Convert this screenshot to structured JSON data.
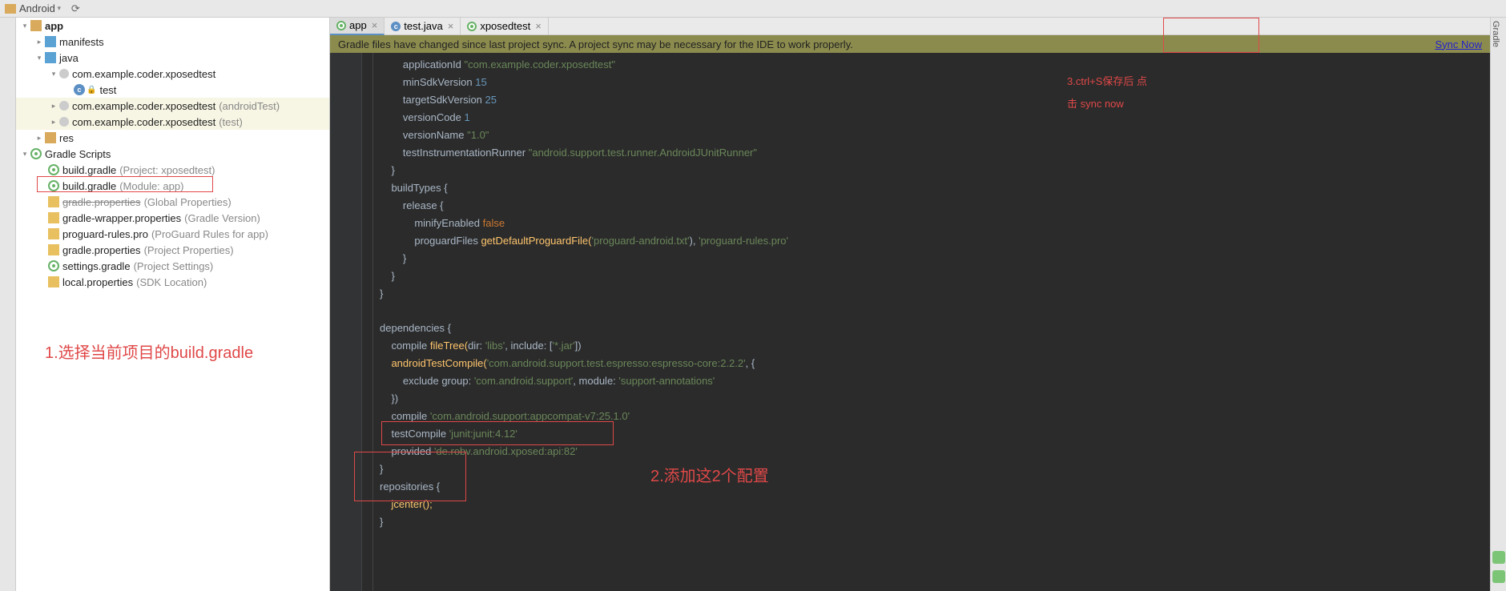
{
  "topbar": {
    "view_label": "Android"
  },
  "tree": {
    "app": "app",
    "manifests": "manifests",
    "java": "java",
    "pkg1": "com.example.coder.xposedtest",
    "test_class": "test",
    "pkg2": "com.example.coder.xposedtest",
    "pkg2_hint": "(androidTest)",
    "pkg3": "com.example.coder.xposedtest",
    "pkg3_hint": "(test)",
    "res": "res",
    "gradle_scripts": "Gradle Scripts",
    "bg_project": "build.gradle",
    "bg_project_hint": "(Project: xposedtest)",
    "bg_module": "build.gradle",
    "bg_module_hint": "(Module: app)",
    "gp_global": "gradle.properties",
    "gp_global_hint": "(Global Properties)",
    "gw": "gradle-wrapper.properties",
    "gw_hint": "(Gradle Version)",
    "proguard": "proguard-rules.pro",
    "proguard_hint": "(ProGuard Rules for app)",
    "gp_proj": "gradle.properties",
    "gp_proj_hint": "(Project Properties)",
    "settings": "settings.gradle",
    "settings_hint": "(Project Settings)",
    "local": "local.properties",
    "local_hint": "(SDK Location)"
  },
  "tabs": {
    "t1": "app",
    "t2": "test.java",
    "t3": "xposedtest"
  },
  "syncbar": {
    "msg": "Gradle files have changed since last project sync. A project sync may be necessary for the IDE to work properly.",
    "link": "Sync Now"
  },
  "code": {
    "l1a": "applicationId ",
    "l1b": "\"com.example.coder.xposedtest\"",
    "l2a": "minSdkVersion ",
    "l2b": "15",
    "l3a": "targetSdkVersion ",
    "l3b": "25",
    "l4a": "versionCode ",
    "l4b": "1",
    "l5a": "versionName ",
    "l5b": "\"1.0\"",
    "l6a": "testInstrumentationRunner ",
    "l6b": "\"android.support.test.runner.AndroidJUnitRunner\"",
    "l7": "}",
    "l8": "buildTypes {",
    "l9": "release {",
    "l10a": "minifyEnabled ",
    "l10b": "false",
    "l11a": "proguardFiles ",
    "l11b": "getDefaultProguardFile(",
    "l11c": "'proguard-android.txt'",
    "l11d": "), ",
    "l11e": "'proguard-rules.pro'",
    "l12": "}",
    "l13": "}",
    "l14": "}",
    "l16": "dependencies {",
    "l17a": "compile ",
    "l17b": "fileTree(",
    "l17c": "dir",
    "l17d": ": ",
    "l17e": "'libs'",
    "l17f": ", ",
    "l17g": "include",
    "l17h": ": [",
    "l17i": "'*.jar'",
    "l17j": "])",
    "l18a": "androidTestCompile(",
    "l18b": "'com.android.support.test.espresso:espresso-core:2.2.2'",
    "l18c": ", {",
    "l19a": "exclude ",
    "l19b": "group",
    "l19c": ": ",
    "l19d": "'com.android.support'",
    "l19e": ", ",
    "l19f": "module",
    "l19g": ": ",
    "l19h": "'support-annotations'",
    "l20": "})",
    "l21a": "compile ",
    "l21b": "'com.android.support:appcompat-v7:25.1.0'",
    "l22a": "testCompile ",
    "l22b": "'junit:junit:4.12'",
    "l23a": "provided ",
    "l23b": "'de.robv.android.xposed:api:82'",
    "l24": "}",
    "l25": "repositories {",
    "l26": "jcenter();",
    "l27": "}"
  },
  "annot": {
    "a1": "1.选择当前项目的build.gradle",
    "a2": "2.添加这2个配置",
    "a3a": "3.ctrl+S保存后 点",
    "a3b": "击 sync now"
  },
  "right_gutter": "Gradle",
  "chart_data": null
}
